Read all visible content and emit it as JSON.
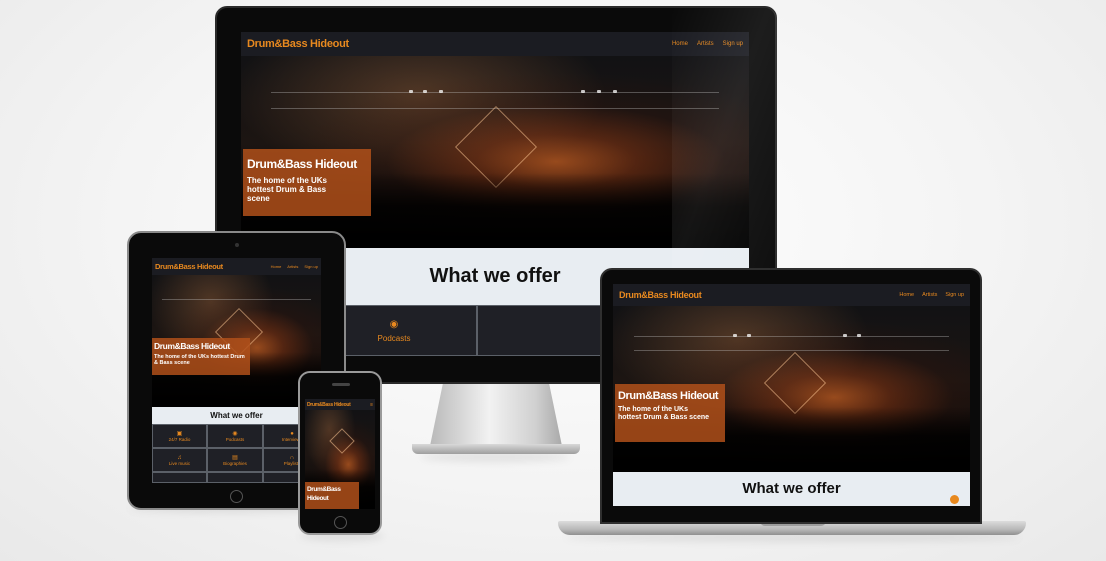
{
  "site": {
    "brand": "Drum&Bass Hideout",
    "nav_links": [
      "Home",
      "Artists",
      "Sign up"
    ],
    "hero_title": "Drum&Bass Hideout",
    "hero_subtitle": "The home of the UKs hottest Drum & Bass scene",
    "section_title": "What we offer",
    "services": [
      {
        "label": "24/7 Radio",
        "icon": "radio-icon"
      },
      {
        "label": "Podcasts",
        "icon": "podcast-icon"
      },
      {
        "label": "Interviews",
        "icon": "microphone-icon"
      },
      {
        "label": "Live music",
        "icon": "music-note-icon"
      },
      {
        "label": "Biographies",
        "icon": "document-icon"
      },
      {
        "label": "Playlists",
        "icon": "headphones-icon"
      }
    ]
  },
  "colors": {
    "accent": "#e8891f",
    "hero_box": "#b0501a",
    "nav_bg": "#1b1c22",
    "section_bg": "#e8edf2"
  }
}
